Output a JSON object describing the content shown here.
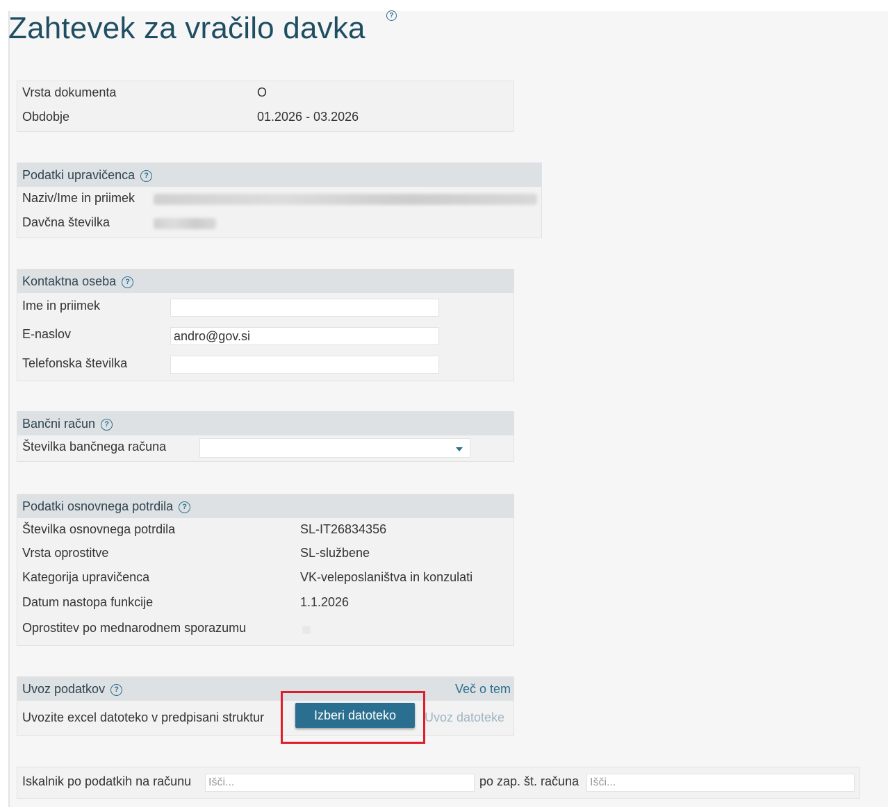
{
  "title": "Zahtevek za vračilo davka",
  "document_info": {
    "rows": [
      {
        "label": "Vrsta dokumenta",
        "value": "O"
      },
      {
        "label": "Obdobje",
        "value": "01.2026 - 03.2026"
      }
    ]
  },
  "beneficiary": {
    "header": "Podatki upravičenca",
    "name_label": "Naziv/Ime in priimek",
    "tax_label": "Davčna številka"
  },
  "contact": {
    "header": "Kontaktna oseba",
    "name_label": "Ime in priimek",
    "name_value": "",
    "email_label": "E-naslov",
    "email_value": "andro@gov.si",
    "phone_label": "Telefonska številka",
    "phone_value": ""
  },
  "bank": {
    "header": "Bančni račun",
    "account_label": "Številka bančnega računa",
    "account_value": ""
  },
  "certificate": {
    "header": "Podatki osnovnega potrdila",
    "rows": [
      {
        "label": "Številka osnovnega potrdila",
        "value": "SL-IT26834356"
      },
      {
        "label": "Vrsta oprostitve",
        "value": "SL-službene"
      },
      {
        "label": "Kategorija upravičenca",
        "value": "VK-veleposlaništva in konzulati"
      },
      {
        "label": "Datum nastopa funkcije",
        "value": "1.1.2026"
      },
      {
        "label": "Oprostitev po mednarodnem sporazumu",
        "value": ""
      }
    ],
    "international_checked": false
  },
  "import": {
    "header": "Uvoz podatkov",
    "more_link": "Več o tem",
    "instruction": "Uvozite excel datoteko v predpisani struktur",
    "choose_button": "Izberi datoteko",
    "import_link": "Uvoz datoteke"
  },
  "search": {
    "label1": "Iskalnik po podatkih na računu",
    "placeholder1": "Išči...",
    "label2": "po zap. št. računa",
    "placeholder2": "Išči..."
  },
  "colors": {
    "accent": "#2a6f8f",
    "highlight": "#e01e2b",
    "title": "#1f4e62"
  }
}
